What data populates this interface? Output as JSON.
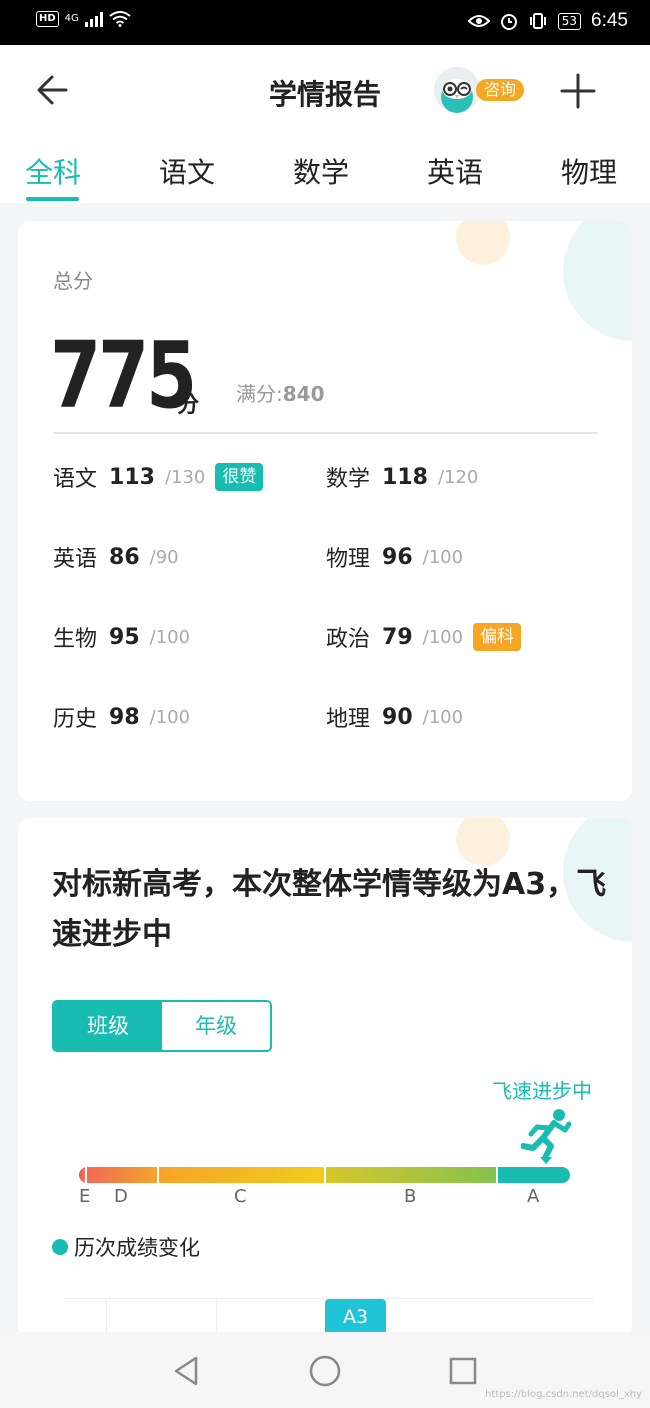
{
  "status_bar": {
    "hd": "HD",
    "network": "4G",
    "battery": "53",
    "time": "6:45"
  },
  "header": {
    "title": "学情报告",
    "consult_label": "咨询"
  },
  "tabs": [
    {
      "label": "全科",
      "active": true
    },
    {
      "label": "语文",
      "active": false
    },
    {
      "label": "数学",
      "active": false
    },
    {
      "label": "英语",
      "active": false
    },
    {
      "label": "物理",
      "active": false
    }
  ],
  "score_card": {
    "total_label": "总分",
    "total_score": "775",
    "unit": "分",
    "full_label": "满分:",
    "full_value": "840",
    "subjects": [
      {
        "name": "语文",
        "score": "113",
        "full": "/130",
        "tag": "很赞",
        "tag_type": "good"
      },
      {
        "name": "数学",
        "score": "118",
        "full": "/120",
        "tag": "",
        "tag_type": ""
      },
      {
        "name": "英语",
        "score": "86",
        "full": "/90",
        "tag": "",
        "tag_type": ""
      },
      {
        "name": "物理",
        "score": "96",
        "full": "/100",
        "tag": "",
        "tag_type": ""
      },
      {
        "name": "生物",
        "score": "95",
        "full": "/100",
        "tag": "",
        "tag_type": ""
      },
      {
        "name": "政治",
        "score": "79",
        "full": "/100",
        "tag": "偏科",
        "tag_type": "warn"
      },
      {
        "name": "历史",
        "score": "98",
        "full": "/100",
        "tag": "",
        "tag_type": ""
      },
      {
        "name": "地理",
        "score": "90",
        "full": "/100",
        "tag": "",
        "tag_type": ""
      }
    ]
  },
  "level_card": {
    "heading": "对标新高考，本次整体学情等级为A3，飞速进步中",
    "toggle": {
      "class_label": "班级",
      "grade_label": "年级",
      "selected": "班级"
    },
    "progress_label": "飞速进步中",
    "grade_letters": [
      "E",
      "D",
      "C",
      "B",
      "A"
    ],
    "legend": "历次成绩变化",
    "current_level": "A3"
  },
  "colors": {
    "accent": "#18bcb0",
    "warn": "#f5a623",
    "bar_red": "#f05a5b",
    "bar_orange": "#f6a623",
    "bar_yellow": "#f2c81e",
    "bar_green": "#8fc24a"
  },
  "watermark": "https://blog.csdn.net/dqsol_xhy"
}
